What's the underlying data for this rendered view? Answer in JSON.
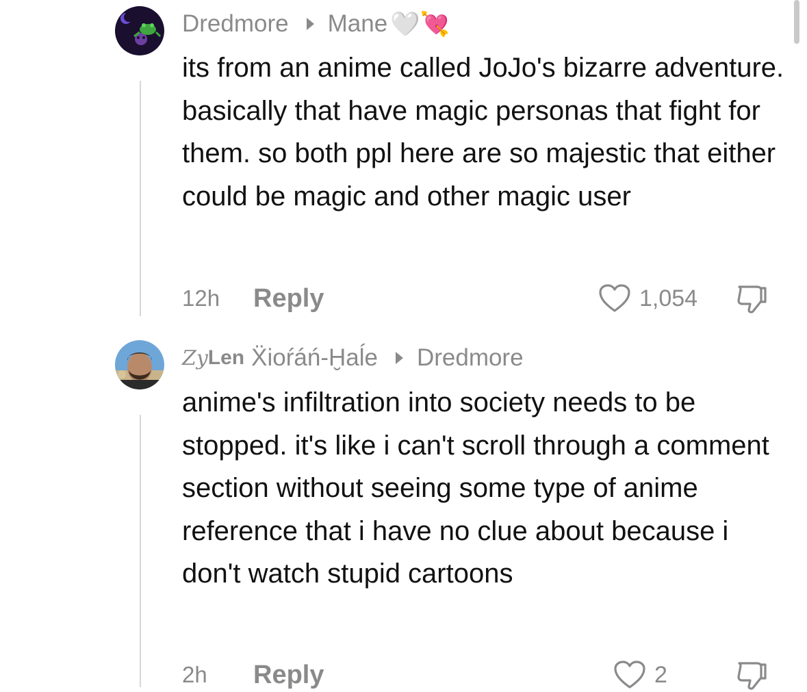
{
  "comments": [
    {
      "author": "Dredmore",
      "reply_to": "Mane",
      "reply_to_emojis": "🤍💘",
      "text": "its from an anime called JoJo's bizarre adventure. basically that have magic personas that fight for them. so both ppl here are so majestic that either could be magic and other magic user",
      "time": "12h",
      "reply_label": "Reply",
      "likes": "1,054"
    },
    {
      "author_italic": "Zy",
      "author_bold": "Len",
      "author_rest": "Ẍioŕáń-Ḫaĺe",
      "reply_to": "Dredmore",
      "text": "anime's infiltration into society needs to be stopped. it's like i can't scroll through a comment section without seeing some type of anime reference that i have no clue about because i don't watch stupid cartoons",
      "time": "2h",
      "reply_label": "Reply",
      "likes": "2"
    }
  ],
  "icons": {
    "like": "heart-outline-icon",
    "dislike": "thumbs-down-outline-icon"
  },
  "colors": {
    "text": "#111111",
    "muted": "#8a8a8a",
    "thread_line": "#d6d6d6"
  }
}
